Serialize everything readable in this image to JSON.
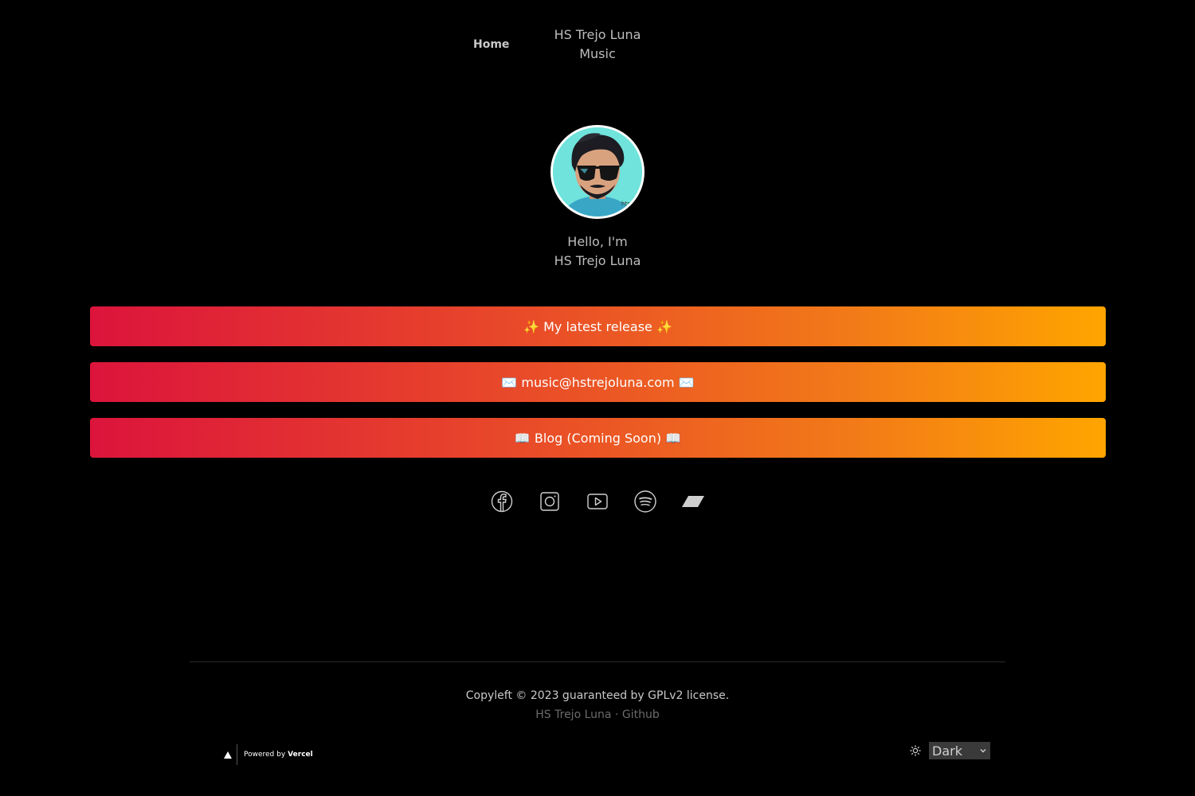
{
  "nav": {
    "home_label": "Home",
    "site_title_line1": "HS Trejo Luna",
    "site_title_line2": "Music"
  },
  "profile": {
    "greeting_line1": "Hello, I'm",
    "greeting_line2": "HS Trejo Luna",
    "avatar_icon": "avatar-image"
  },
  "links": [
    {
      "label": "✨ My latest release ✨"
    },
    {
      "label": "✉️ music@hstrejoluna.com ✉️"
    },
    {
      "label": "📖 Blog (Coming Soon) 📖"
    }
  ],
  "socials": [
    {
      "icon": "facebook-icon"
    },
    {
      "icon": "instagram-icon"
    },
    {
      "icon": "youtube-icon"
    },
    {
      "icon": "spotify-icon"
    },
    {
      "icon": "bandcamp-icon"
    }
  ],
  "footer": {
    "copyleft": "Copyleft © 2023 guaranteed by GPLv2 license.",
    "author_link": "HS Trejo Luna",
    "separator": "·",
    "github_link": "Github",
    "vercel_prefix": "Powered by",
    "vercel_brand": "Vercel",
    "theme_value": "Dark"
  },
  "colors": {
    "background": "#000000",
    "gradient_start": "#dc143c",
    "gradient_end": "#ffa500",
    "avatar_bg": "#6fe3dc"
  }
}
